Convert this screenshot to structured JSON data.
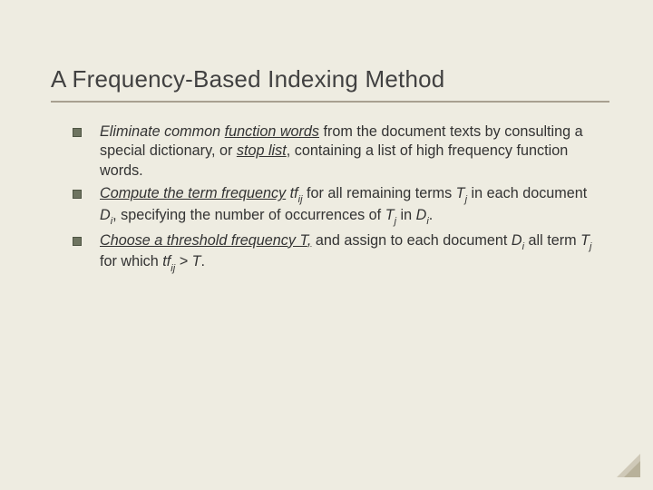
{
  "title": "A Frequency-Based Indexing Method",
  "bullets": [
    {
      "p1": "Eliminate common ",
      "uw": "function words",
      "p2": " from the document texts by consulting a special dictionary, or ",
      "uw2": "stop list",
      "p3": ", containing a list of high frequency function words."
    },
    {
      "p1": "Compute the term frequency",
      "tf": " tf",
      "sub1": "ij",
      "p2": " for all remaining terms ",
      "T1": "T",
      "subT1": "j",
      "p3": " in each document ",
      "D1": "D",
      "subD1": "i",
      "p4": ", specifying the number of occurrences of ",
      "T2": "T",
      "subT2": "j",
      "p5": " in ",
      "D2": "D",
      "subD2": "i",
      "p6": "."
    },
    {
      "p1": "Choose a threshold frequency ",
      "Tval": "T",
      "p1b": ",",
      "p2": " and assign to each document ",
      "D1": "D",
      "subD1": "i",
      "p3": " all term ",
      "T1": "T",
      "subT1": "j",
      "p4": " for which ",
      "tf": "tf",
      "sub1": "ij",
      "gt": " > T",
      "p5": "."
    }
  ]
}
